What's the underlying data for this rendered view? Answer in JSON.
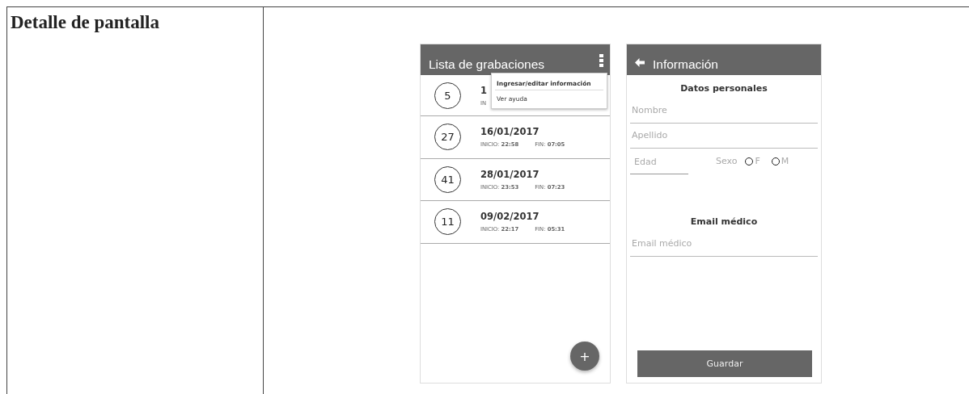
{
  "table": {
    "heading": "Detalle de pantalla"
  },
  "list_screen": {
    "title": "Lista de grabaciones",
    "menu": [
      {
        "label": "Ingresar/editar información",
        "bold": true
      },
      {
        "label": "Ver ayuda",
        "bold": false
      }
    ],
    "recordings": [
      {
        "count": "5",
        "date": "1",
        "start_label": "IN"
      },
      {
        "count": "27",
        "date": "16/01/2017",
        "start_label": "INICIO:",
        "start": "22:58",
        "end_label": "FIN:",
        "end": "07:05"
      },
      {
        "count": "41",
        "date": "28/01/2017",
        "start_label": "INICIO:",
        "start": "23:53",
        "end_label": "FIN:",
        "end": "07:23"
      },
      {
        "count": "11",
        "date": "09/02/2017",
        "start_label": "INICIO:",
        "start": "22:17",
        "end_label": "FIN:",
        "end": "05:31"
      }
    ],
    "fab": "+"
  },
  "info_screen": {
    "title": "Información",
    "sections": [
      {
        "heading": "Datos personales",
        "fields": [
          {
            "kind": "text",
            "placeholder": "Nombre"
          },
          {
            "kind": "text",
            "placeholder": "Apellido"
          },
          {
            "kind": "age_sex",
            "placeholder": "Edad",
            "sex_label": "Sexo",
            "options": [
              {
                "label": "F",
                "selected": false
              },
              {
                "label": "M",
                "selected": false
              }
            ]
          }
        ]
      },
      {
        "heading": "Email médico",
        "fields": [
          {
            "kind": "text",
            "placeholder": "Email médico"
          }
        ]
      }
    ],
    "button": "Guardar"
  }
}
